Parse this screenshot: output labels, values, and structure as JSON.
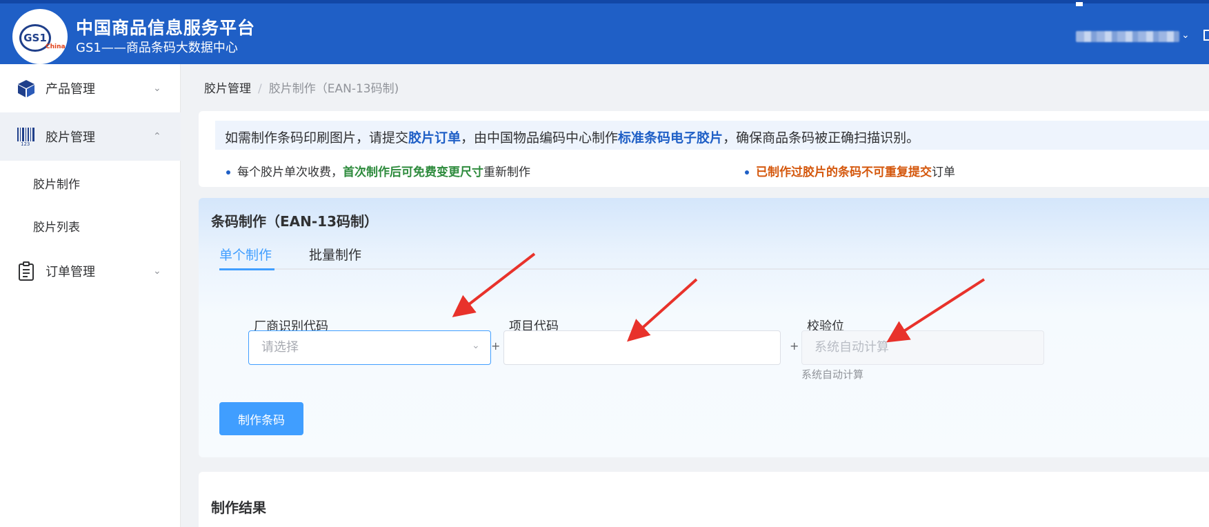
{
  "header": {
    "logo_text": "GS1",
    "logo_region": "China",
    "title": "中国商品信息服务平台",
    "subtitle": "GS1——商品条码大数据中心",
    "brand_color": "#1f5fc6"
  },
  "sidebar": {
    "items": [
      {
        "label": "产品管理",
        "icon": "box-icon",
        "expanded": false
      },
      {
        "label": "胶片管理",
        "icon": "barcode-icon",
        "expanded": true
      },
      {
        "label": "订单管理",
        "icon": "clipboard-icon",
        "expanded": false
      }
    ],
    "sub_items": [
      {
        "label": "胶片制作"
      },
      {
        "label": "胶片列表"
      }
    ]
  },
  "breadcrumb": {
    "parent": "胶片管理",
    "separator": "/",
    "current": "胶片制作（EAN-13码制)"
  },
  "notice": {
    "part1": "如需制作条码印刷图片，请提交",
    "bold1": "胶片订单",
    "part2": "，由中国物品编码中心制作",
    "bold2": "标准条码电子胶片",
    "part3": "，确保商品条码被正确扫描识别。",
    "bullet1_pre": "每个胶片单次收费，",
    "bullet1_bold": "首次制作后可免费变更尺寸",
    "bullet1_post": "重新制作",
    "bullet2_bold": "已制作过胶片的条码不可重复提交",
    "bullet2_post": "订单"
  },
  "form": {
    "title": "条码制作（EAN-13码制）",
    "tabs": [
      {
        "label": "单个制作",
        "active": true
      },
      {
        "label": "批量制作",
        "active": false
      }
    ],
    "fields": {
      "manufacturer": {
        "label": "厂商识别代码",
        "placeholder": "请选择"
      },
      "item_code": {
        "label": "项目代码",
        "value": ""
      },
      "check_digit": {
        "label": "校验位",
        "placeholder": "系统自动计算",
        "hint": "系统自动计算"
      }
    },
    "plus_sign": "+",
    "submit_label": "制作条码"
  },
  "result": {
    "title": "制作结果"
  }
}
